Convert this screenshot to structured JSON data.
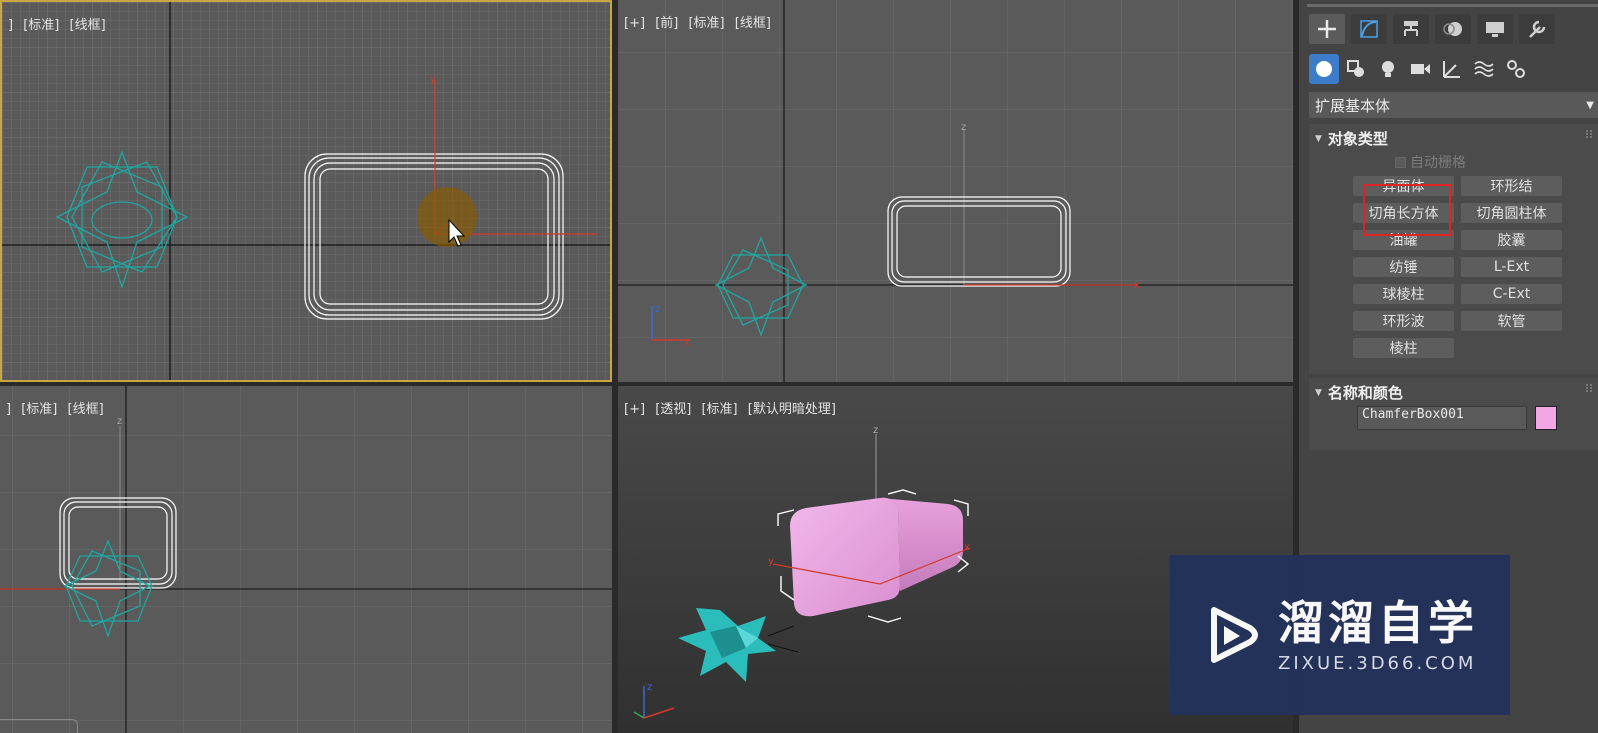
{
  "viewports": {
    "top": {
      "labels": [
        "]",
        "[标准]",
        "[线框]"
      ]
    },
    "front": {
      "labels": [
        "[+]",
        "[前]",
        "[标准]",
        "[线框]"
      ]
    },
    "left": {
      "labels": [
        "]",
        "[标准]",
        "[线框]"
      ]
    },
    "persp": {
      "labels": [
        "[+]",
        "[透视]",
        "[标准]",
        "[默认明暗处理]"
      ]
    }
  },
  "axis_labels": {
    "x": "x",
    "y": "y",
    "z": "z"
  },
  "command_panel": {
    "tabs": [
      "create-icon",
      "modify-icon",
      "hierarchy-icon",
      "motion-icon",
      "display-icon",
      "utilities-icon"
    ],
    "subtabs": [
      "geometry-icon",
      "shapes-icon",
      "lights-icon",
      "cameras-icon",
      "helpers-icon",
      "spacewarps-icon",
      "systems-icon"
    ],
    "dropdown": "扩展基本体",
    "object_type": {
      "title": "对象类型",
      "autogrid": "自动栅格",
      "buttons": [
        "异面体",
        "环形结",
        "切角长方体",
        "切角圆柱体",
        "油罐",
        "胶囊",
        "纺锤",
        "L-Ext",
        "球棱柱",
        "C-Ext",
        "环形波",
        "软管",
        "棱柱"
      ]
    },
    "name_color": {
      "title": "名称和颜色",
      "name": "ChamferBox001",
      "color": "#f2a6e6"
    }
  },
  "colors": {
    "accent": "#3d7cc9",
    "highlight": "#e02424",
    "hedra": "#2ec4c4",
    "box_solid": "#e8a6e0"
  },
  "watermark": {
    "title": "溜溜自学",
    "url": "ZIXUE.3D66.COM"
  }
}
